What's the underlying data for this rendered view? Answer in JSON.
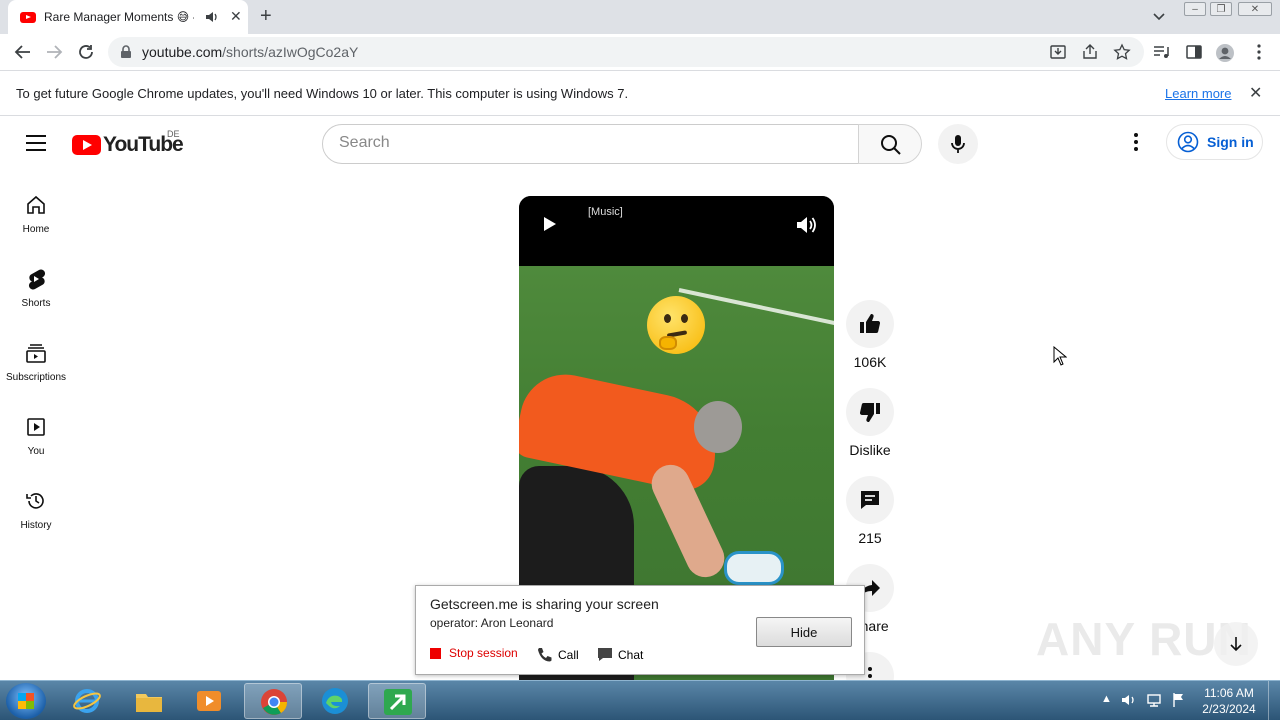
{
  "browser": {
    "tab_title": "Rare Manager Moments 😅 -",
    "url_domain": "youtube.com",
    "url_path": "/shorts/azIwOgCo2aY",
    "infobar_message": "To get future Google Chrome updates, you'll need Windows 10 or later. This computer is using Windows 7.",
    "infobar_link": "Learn more"
  },
  "youtube": {
    "logo_text": "YouTube",
    "country_code": "DE",
    "search_placeholder": "Search",
    "sign_in_label": "Sign in",
    "guide": [
      {
        "label": "Home",
        "icon": "home-icon"
      },
      {
        "label": "Shorts",
        "icon": "shorts-icon"
      },
      {
        "label": "Subscriptions",
        "icon": "subscriptions-icon"
      },
      {
        "label": "You",
        "icon": "you-icon"
      },
      {
        "label": "History",
        "icon": "history-icon"
      }
    ],
    "player": {
      "caption": "[Music]"
    },
    "actions": {
      "likes": "106K",
      "dislike_label": "Dislike",
      "comments": "215",
      "share_label": "Share"
    }
  },
  "getscreen": {
    "title": "Getscreen.me is sharing your screen",
    "operator": "operator: Aron Leonard",
    "hide_label": "Hide",
    "stop_label": "Stop session",
    "call_label": "Call",
    "chat_label": "Chat"
  },
  "watermark": "ANY RUN",
  "taskbar": {
    "time": "11:06 AM",
    "date": "2/23/2024"
  },
  "colors": {
    "youtube_red": "#ff0000",
    "link_blue": "#1a73e8",
    "signin_blue": "#065fd4",
    "stop_red": "#dd0000"
  }
}
